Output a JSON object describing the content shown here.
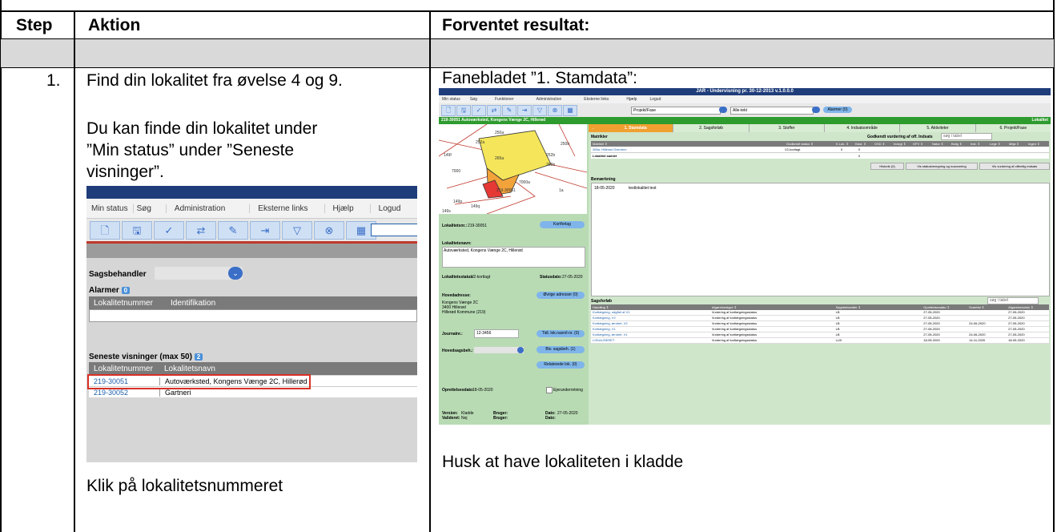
{
  "table": {
    "headers": {
      "step": "Step",
      "action": "Aktion",
      "expected": "Forventet resultat:"
    },
    "row": {
      "step_no": "1.",
      "action_lines": [
        "Find din lokalitet fra øvelse 4 og 9.",
        "Du kan finde din lokalitet under",
        "”Min status” under ”Seneste",
        "visninger”.",
        "Klik på lokalitetsnummeret"
      ],
      "expected_lines": [
        "Fanebladet ”1. Stamdata”:",
        "Husk at have lokaliteten i kladde"
      ]
    }
  },
  "shot1": {
    "menu": [
      "Min status",
      "Søg",
      "Administration",
      "Eksterne links",
      "Hjælp",
      "Logud"
    ],
    "toolbar_icons": [
      "new-document-icon",
      "save-icon",
      "check-circle-icon",
      "transfer-icon",
      "edit-chart-icon",
      "export-icon",
      "filter-icon",
      "cancel-circle-icon",
      "calculator-icon"
    ],
    "sagsbehandler_label": "Sagsbehandler",
    "alarmer_label": "Alarmer",
    "alarmer_count": "0",
    "alarm_cols": [
      "Lokalitetnummer",
      "Identifikation"
    ],
    "seneste_label": "Seneste visninger (max 50)",
    "seneste_count": "2",
    "seneste_cols": [
      "Lokalitetnummer",
      "Lokalitetsnavn"
    ],
    "seneste_rows": [
      {
        "nr": "219-30051",
        "navn": "Autoværksted, Kongens Vænge 2C, Hillerød"
      },
      {
        "nr": "219-30052",
        "navn": "Gartneri"
      }
    ]
  },
  "shot2": {
    "title": "JAR - Undervisning pr. 30-12-2013 v.1.0.0.0",
    "menu": [
      "Min status",
      "Søg",
      "Funktioner",
      "Administration",
      "Eksterne links",
      "Hjælp",
      "Logud"
    ],
    "selects": [
      "Projekt/Fase",
      "Alle-tekt"
    ],
    "alarm_btn": "Alarmer (0)",
    "location_bar": "219-30051 Autoværksted, Kongens Vænge 2C, Hillerød",
    "location_bar_right": "Lokalitet",
    "tabs": [
      "1. Stamdata",
      "2. Sagsforløb",
      "3. Stoffer",
      "4. Indsatsområde",
      "5. Aktiviteter",
      "6. Projekt/Fase"
    ],
    "map_labels": [
      "252a",
      "250a",
      "250b",
      "252b",
      "265a",
      "149f",
      "7000",
      "149q",
      "149s",
      "149p",
      "265b",
      "7000a",
      "1a",
      "219-30051"
    ],
    "lokalitetsnr_label": "Lokalitetsnr.:",
    "lokalitetsnr_value": "219-30051",
    "kortforlag": "Kortforlag",
    "lokalitetsnavn_label": "Lokalitetsnavn:",
    "lokalitetsnavn_value": "Autoværksted, Kongens Vænge 2C, Hillerød",
    "status_label": "Lokalitetsstatus:",
    "status_value": "V2-kortlagt",
    "statusdato_label": "Statusdato:",
    "statusdato_value": "27-05-2020",
    "hovedadresse_label": "Hovedadresse:",
    "hovedadresse_lines": [
      "Kongens Vænge 2C",
      "3400 Hillerød",
      "Hillerød Kommune (219)"
    ],
    "ovrige_btn": "Øvrige adresser (0)",
    "journal_label": "Journalnr.:",
    "journal_value": "12-3456",
    "tidl_btn": "Tidl. lok.navn/l-nr. (0)",
    "hovedsag_label": "Hovedsagsbeh.:",
    "biv_btn": "Biv. sagsbeh. (1)",
    "relaterede_btn": "Relaterede lok. (0)",
    "oprettet_label": "Oprettelsesdato:",
    "oprettet_value": "18-05-2020",
    "ejerunder_label": "Ejerunderretning",
    "version_label": "Version:",
    "version_value": "Kladde",
    "valideret_label": "Valideret:",
    "valideret_value": "Nej",
    "bruger_label": "Bruger:",
    "dato_label": "Dato:",
    "dato_value": "27-05-2020",
    "matrikler_label": "Matrikler",
    "godkendt_label": "Godkendt vurdering af off. Indsats",
    "search_placeholder": "søg i tabel",
    "matrikel_cols": [
      "Matrikel",
      "Godkendt status",
      "K.Lok.",
      "Kład.",
      "OSD",
      "Indvgt",
      "OFV",
      "Natur",
      "Bolig",
      "Inst.",
      "Lege",
      "Miljø",
      "Ingen"
    ],
    "matrikel_rows": [
      {
        "name": "265a, Hillerød Overdrev",
        "status": "V2-kortlagt",
        "k": "0",
        "kl": "0"
      },
      {
        "name": "Lokalitet samlet",
        "status": "",
        "k": "",
        "kl": "0"
      }
    ],
    "historik_btn": "Historik (0)",
    "vis_status_btn": "Vis statusberegning og nuancering",
    "vis_vurd_btn": "Vis vurdering af offentlig indsats",
    "bemaerkning_label": "Bemærkning",
    "bemaerkning_date": "18-05-2020",
    "bemaerkning_text": "testlokalitet test",
    "sagsforlob_label": "Sagsforløb",
    "sags_cols": [
      "Handling",
      "Afgørelsestype",
      "Sagsbehandler",
      "Oprettelsesdato",
      "Svarfrist",
      "Afgørelsesdato"
    ],
    "sags_rows": [
      {
        "h": "Kortlægning, udgået af V1",
        "a": "Vurdering af kortlægningsstatus",
        "s": "LB",
        "o": "27-05-2020",
        "sv": "",
        "ad": "27-05-2020"
      },
      {
        "h": "Kortlægning, V2",
        "a": "Vurdering af kortlægningsstatus",
        "s": "LB",
        "o": "27-05-2020",
        "sv": "",
        "ad": "27-05-2020"
      },
      {
        "h": "Kortlægning, ændret, V2",
        "a": "Vurdering af kortlægningsstatus",
        "s": "LB",
        "o": "27-05-2020",
        "sv": "24-06-2020",
        "ad": "27-05-2020"
      },
      {
        "h": "Kortlægning, V1",
        "a": "Vurdering af kortlægningsstatus",
        "s": "LB",
        "o": "27-05-2020",
        "sv": "",
        "ad": "27-05-2020"
      },
      {
        "h": "Kortlægning, ændret, V1",
        "a": "Vurdering af kortlægningsstatus",
        "s": "LB",
        "o": "27-05-2020",
        "sv": "24-06-2020",
        "ad": "27-05-2020"
      },
      {
        "h": "LOKALISERET",
        "a": "Vurdering af kortlægningsstatus",
        "s": "LUX",
        "o": "18-05-2020",
        "sv": "14-11-2020",
        "ad": "18-05-2020"
      }
    ]
  }
}
